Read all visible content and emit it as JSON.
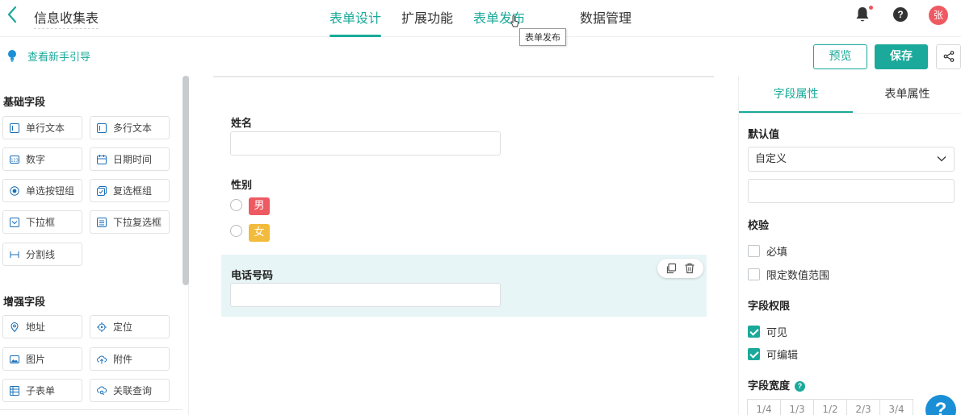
{
  "header": {
    "title": "信息收集表",
    "tabs": [
      {
        "label": "表单设计"
      },
      {
        "label": "扩展功能"
      },
      {
        "label": "表单发布"
      },
      {
        "label": "数据管理"
      }
    ],
    "tooltip": "表单发布",
    "avatar_text": "张",
    "icons": [
      "back-arrow-icon",
      "bell-icon",
      "help-icon"
    ]
  },
  "toolbar": {
    "guide_label": "查看新手引导",
    "preview_label": "预览",
    "save_label": "保存"
  },
  "left_panel": {
    "basic_title": "基础字段",
    "basic_fields": [
      {
        "label": "单行文本"
      },
      {
        "label": "多行文本"
      },
      {
        "label": "数字"
      },
      {
        "label": "日期时间"
      },
      {
        "label": "单选按钮组"
      },
      {
        "label": "复选框组"
      },
      {
        "label": "下拉框"
      },
      {
        "label": "下拉复选框"
      },
      {
        "label": "分割线"
      }
    ],
    "enhanced_title": "增强字段",
    "enhanced_fields": [
      {
        "label": "地址"
      },
      {
        "label": "定位"
      },
      {
        "label": "图片"
      },
      {
        "label": "附件"
      },
      {
        "label": "子表单"
      },
      {
        "label": "关联查询"
      }
    ]
  },
  "form": {
    "name_label": "姓名",
    "gender_label": "性别",
    "gender_options": [
      {
        "label": "男",
        "color": "#ee5a62"
      },
      {
        "label": "女",
        "color": "#f2bb3c"
      }
    ],
    "phone_label": "电话号码"
  },
  "right_panel": {
    "tabs": [
      {
        "label": "字段属性"
      },
      {
        "label": "表单属性"
      }
    ],
    "default_title": "默认值",
    "default_select": "自定义",
    "validation_title": "校验",
    "validation_options": [
      {
        "label": "必填",
        "checked": false
      },
      {
        "label": "限定数值范围",
        "checked": false
      }
    ],
    "permission_title": "字段权限",
    "permission_options": [
      {
        "label": "可见",
        "checked": true
      },
      {
        "label": "可编辑",
        "checked": true
      }
    ],
    "width_title": "字段宽度",
    "width_options": [
      "1/4",
      "1/3",
      "1/2",
      "2/3",
      "3/4"
    ]
  },
  "colors": {
    "accent": "#1aa99a",
    "selected_bg": "#e8f5f6",
    "help_fab": "#1a8fd6"
  }
}
